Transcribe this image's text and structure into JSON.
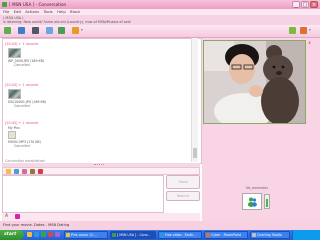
{
  "window": {
    "title": "[ MSN USA ] - Conversation",
    "controls": {
      "minimize": "_",
      "maximize": "□",
      "close": "×"
    }
  },
  "menu": [
    "File",
    "Edit",
    "Actions",
    "Tools",
    "Help",
    "Block"
  ],
  "status_message": {
    "line1": "( MSN USA )",
    "line2": "is listening: New world/ Same old old (Laundry), mas of MSN/Musica of sale"
  },
  "transfers": [
    {
      "header": "[20:43] + 1 records",
      "name": "WP_0049.JPG (189 KB)",
      "status": "Cancelled"
    },
    {
      "header": "[20:43] + 1 records",
      "name": "DSC00001.JPG (189 KB)",
      "status": "Cancelled"
    },
    {
      "header": "[20:43] + 1 records",
      "name": "My Pics",
      "name2": "MUSIC.MP3 (170 KB)",
      "status": "Cancelled"
    }
  ],
  "connecting_text": "Connection established",
  "send_button": "Send",
  "search_button": "Search",
  "format_letter": "A",
  "my_display_name": "fat_mermaids",
  "webcam_close": "x",
  "view_footer": "Find your movie. Dates - MSN Dating",
  "taskbar": {
    "start": "start",
    "tasks": [
      {
        "label": "Pink colour (C:..."
      },
      {
        "label": "[ MSN USA ] - Conv...",
        "active": true
      },
      {
        "label": "Free video - Earth..."
      },
      {
        "label": "Cyber - PowerPoint"
      },
      {
        "label": "Charting Studio"
      }
    ]
  },
  "colors": {
    "theme_pink": "#f7c3dc",
    "taskbar_blue": "#245ed6",
    "start_green": "#3a9a36"
  }
}
